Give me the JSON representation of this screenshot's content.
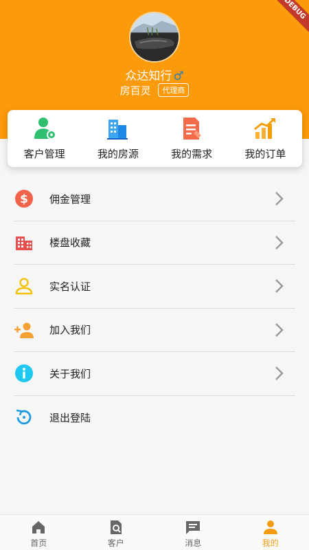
{
  "header": {
    "username": "众达知行",
    "gender_symbol": "♂",
    "real_name": "房百灵",
    "role_badge": "代理商",
    "banner_text": "DEBUG"
  },
  "quick_actions": [
    {
      "label": "客户管理",
      "icon": "customer-manage-icon"
    },
    {
      "label": "我的房源",
      "icon": "building-icon"
    },
    {
      "label": "我的需求",
      "icon": "document-edit-icon"
    },
    {
      "label": "我的订单",
      "icon": "growth-chart-icon"
    }
  ],
  "menu": [
    {
      "label": "佣金管理",
      "icon": "dollar-icon",
      "has_arrow": true
    },
    {
      "label": "楼盘收藏",
      "icon": "buildings-icon",
      "has_arrow": true
    },
    {
      "label": "实名认证",
      "icon": "person-outline-icon",
      "has_arrow": true
    },
    {
      "label": "加入我们",
      "icon": "add-person-icon",
      "has_arrow": true
    },
    {
      "label": "关于我们",
      "icon": "info-icon",
      "has_arrow": true
    },
    {
      "label": "退出登陆",
      "icon": "logout-refresh-icon",
      "has_arrow": false
    }
  ],
  "tabbar": [
    {
      "label": "首页",
      "icon": "home-icon",
      "active": false
    },
    {
      "label": "客户",
      "icon": "customer-search-icon",
      "active": false
    },
    {
      "label": "消息",
      "icon": "message-icon",
      "active": false
    },
    {
      "label": "我的",
      "icon": "person-icon",
      "active": true
    }
  ],
  "colors": {
    "brand_orange": "#fb9a0a",
    "active_tab": "#f39c12"
  }
}
